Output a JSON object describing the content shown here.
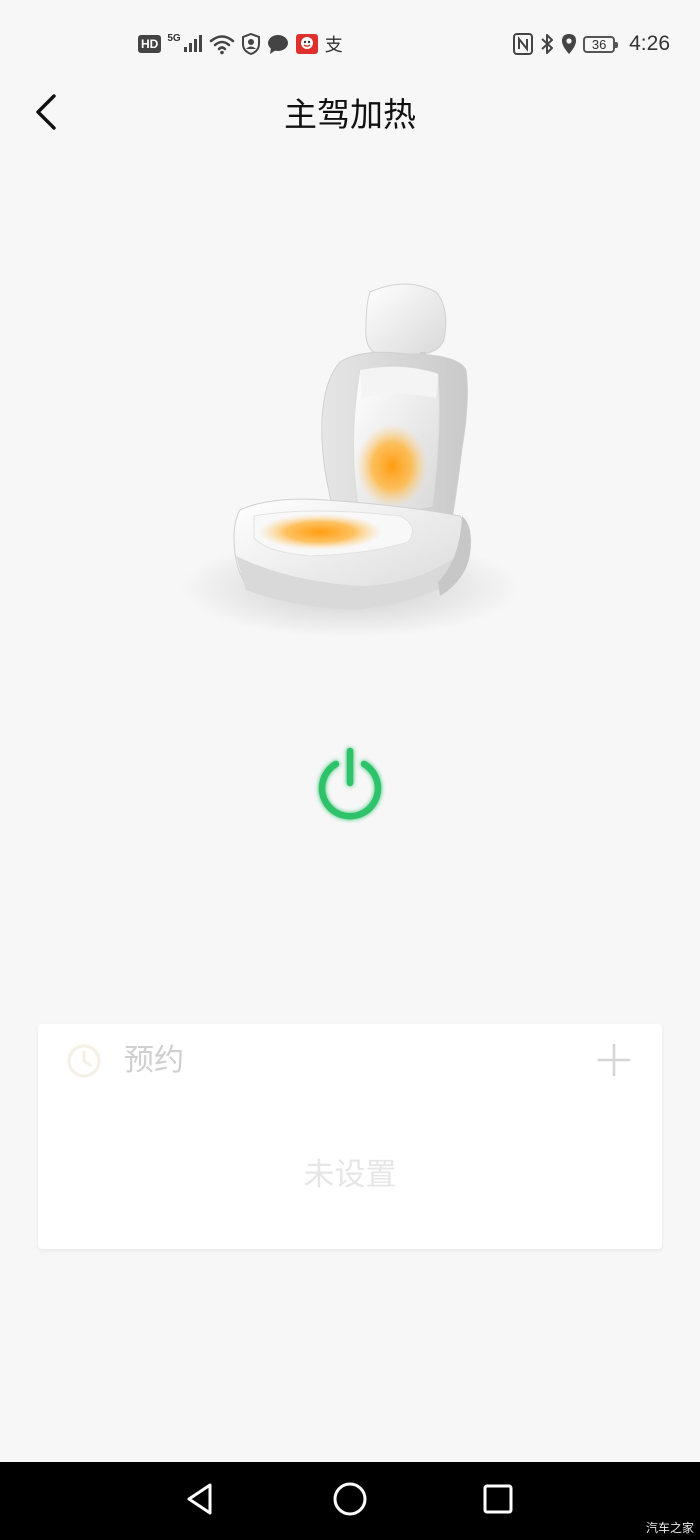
{
  "status_bar": {
    "left_icons": [
      "hd-icon",
      "5g-signal-icon",
      "wifi-icon",
      "profile-shield-icon",
      "chat-icon",
      "app-icon",
      "alipay-icon"
    ],
    "hd_label": "HD",
    "network_label": "5G",
    "alipay_label": "支",
    "right_icons": [
      "nfc-icon",
      "bluetooth-icon",
      "location-icon",
      "battery-icon"
    ],
    "battery_level": "36",
    "time": "4:26"
  },
  "header": {
    "title": "主驾加热"
  },
  "seat": {
    "heating_active": true,
    "heat_color": "#ffa21e"
  },
  "power": {
    "state": "on",
    "color": "#2dc26b"
  },
  "schedule": {
    "title": "预约",
    "empty_text": "未设置"
  },
  "nav_bar": {
    "watermark": "汽车之家"
  }
}
